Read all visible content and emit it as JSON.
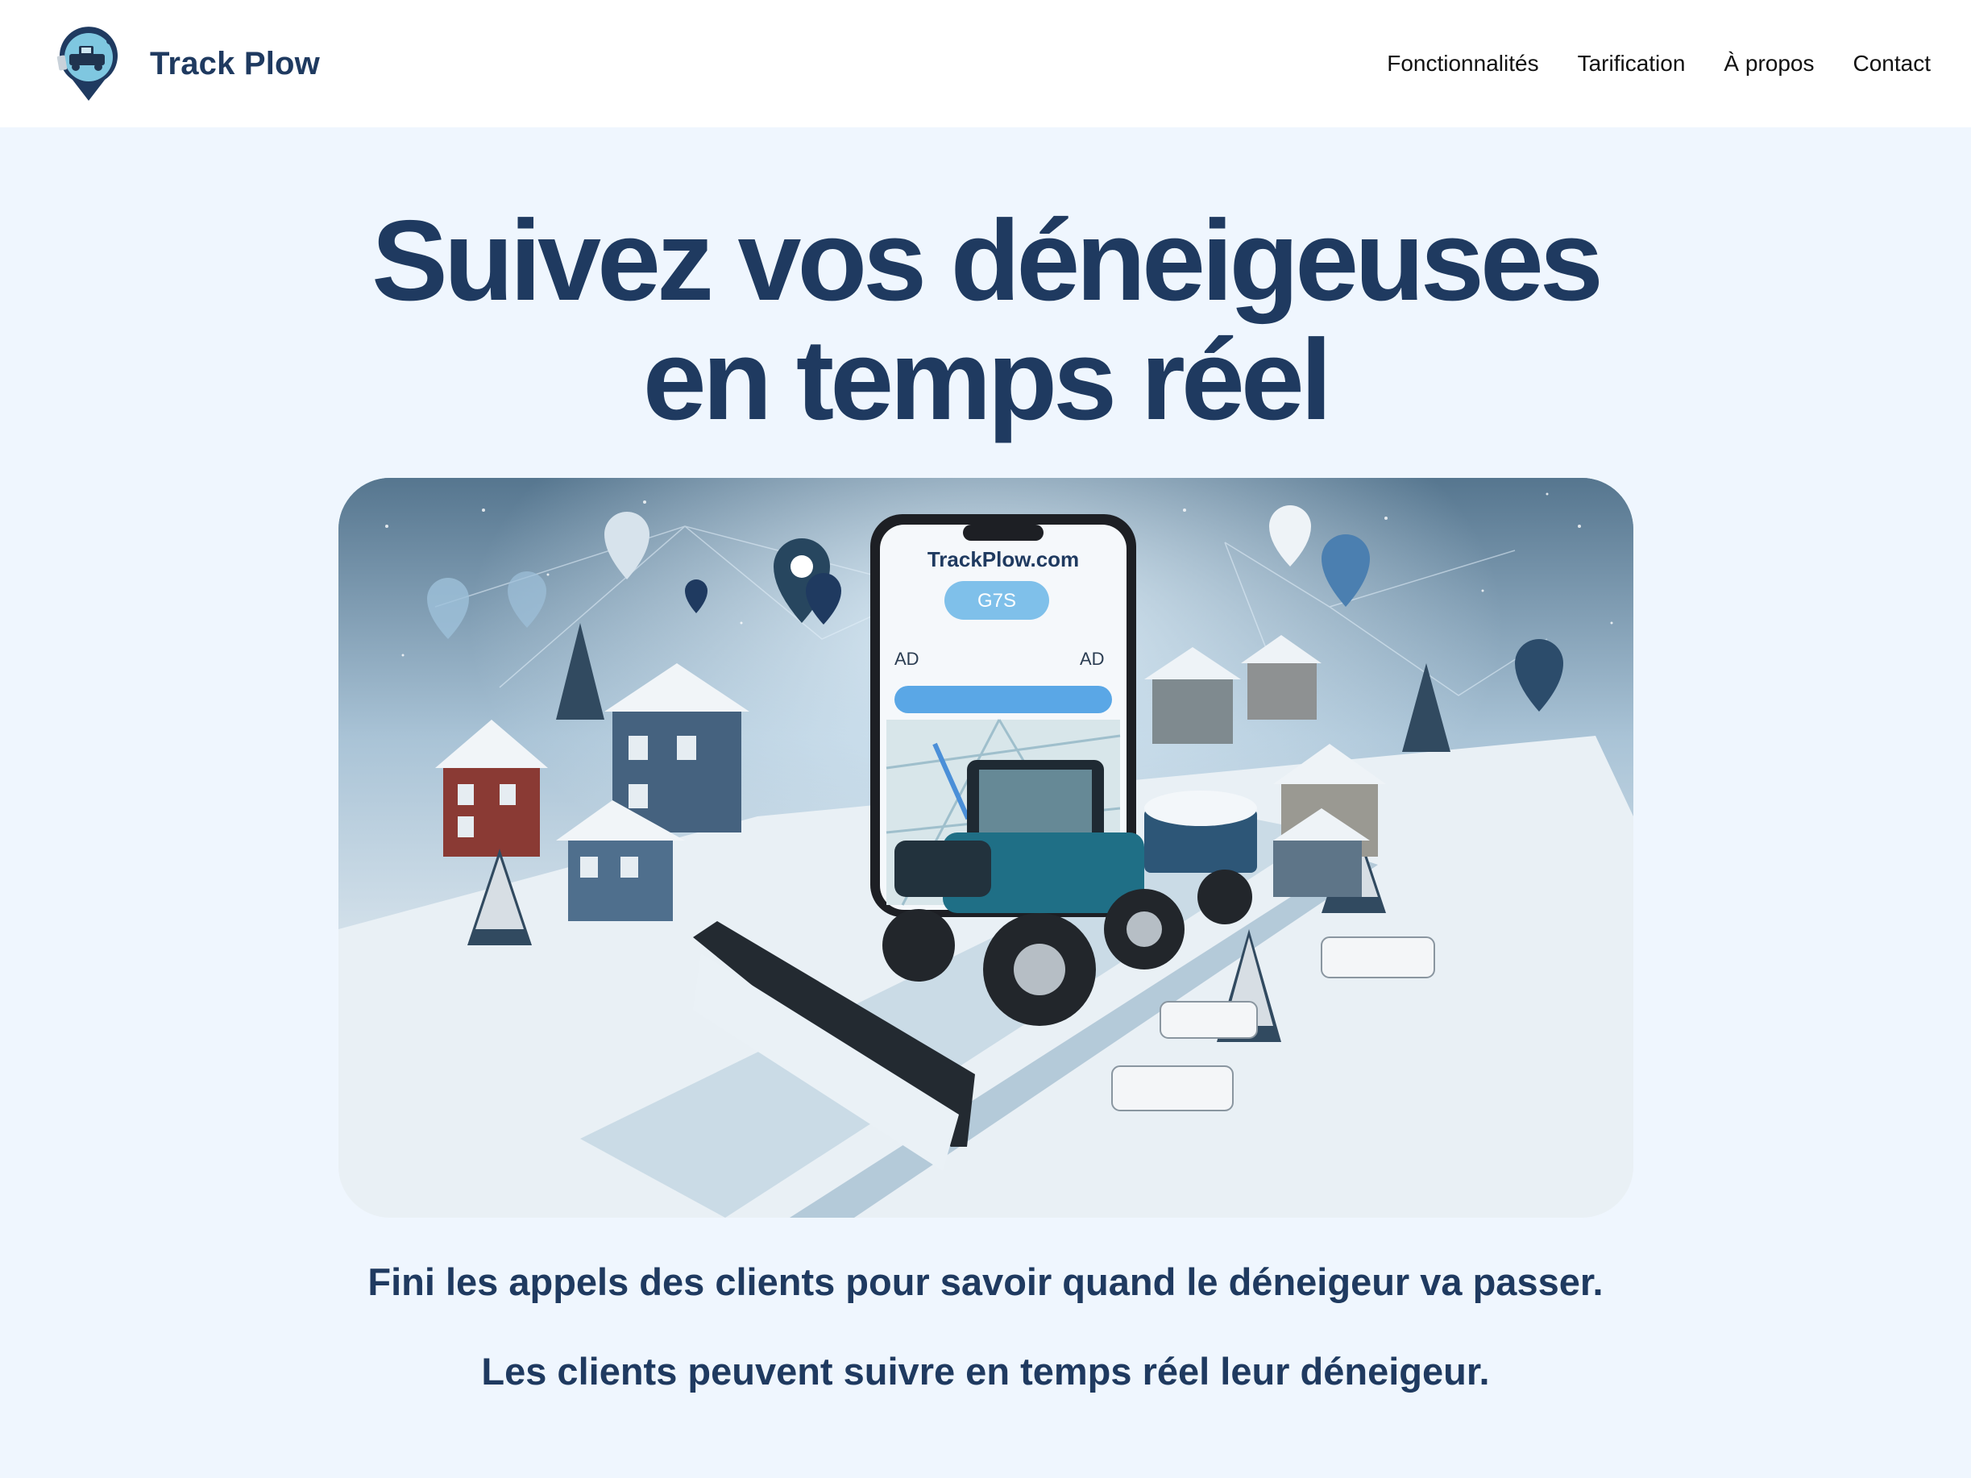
{
  "header": {
    "brand_name": "Track Plow",
    "logo_icon": "snowplow-pin-logo",
    "nav": [
      {
        "label": "Fonctionnalités"
      },
      {
        "label": "Tarification"
      },
      {
        "label": "À propos"
      },
      {
        "label": "Contact"
      }
    ]
  },
  "hero": {
    "title_line1": "Suivez vos déneigeuses",
    "title_line2": "en temps réel",
    "image": {
      "icon": "snowplow-tracking-illustration",
      "phone_site": "TrackPlow.com",
      "phone_badge": "G7S",
      "phone_left_label": "AD",
      "phone_right_label": "AD"
    }
  },
  "taglines": [
    "Fini les appels des clients pour savoir quand le déneigeur va passer.",
    "Les clients peuvent suivre en temps réel leur déneigeur."
  ],
  "colors": {
    "primary": "#1f3a60",
    "background": "#eff6fe",
    "header_bg": "#ffffff",
    "nav_text": "#111111"
  }
}
